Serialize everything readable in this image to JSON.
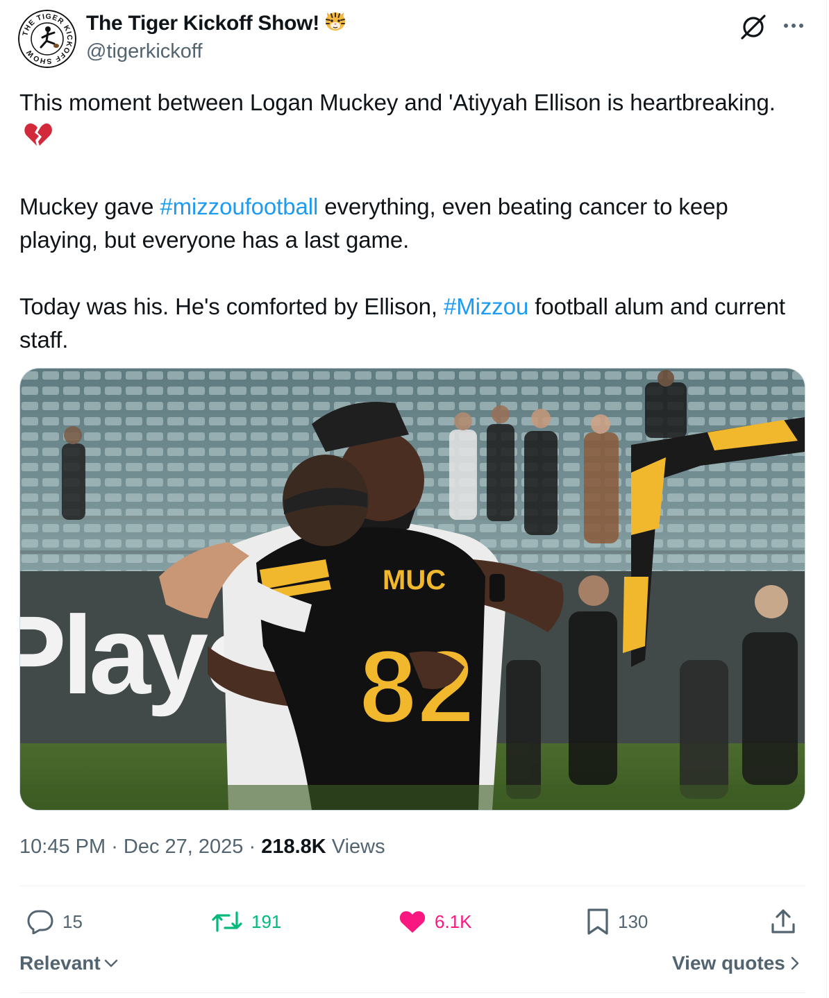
{
  "author": {
    "display_name": "The Tiger Kickoff Show!",
    "handle": "@tigerkickoff",
    "avatar_ring_text": "THE TIGER KICKOFF SHOW",
    "name_emoji": "tiger-face-emoji"
  },
  "tweet": {
    "p1_text": "This moment between Logan Muckey and 'Atiyyah Ellison is heartbreaking.",
    "p1_emoji": "broken-heart-emoji",
    "p2_before": "Muckey gave ",
    "p2_hashtag": "#mizzoufootball",
    "p2_after": " everything, even beating cancer to keep playing, but everyone has a last game.",
    "p3_before": "Today was his. He's comforted by Ellison, ",
    "p3_hashtag": "#Mizzou",
    "p3_after": " football alum and current staff."
  },
  "media": {
    "banner_text": "Playe",
    "jersey_name": "MUC",
    "jersey_number": "82"
  },
  "meta": {
    "time": "10:45 PM",
    "sep1": " · ",
    "date": "Dec 27, 2025",
    "sep2": " · ",
    "views_count": "218.8K",
    "views_label": " Views"
  },
  "actions": {
    "replies": "15",
    "reposts": "191",
    "likes": "6.1K",
    "bookmarks": "130"
  },
  "footer": {
    "sort_label": "Relevant",
    "quotes_label": "View quotes"
  },
  "colors": {
    "link": "#1d9bf0",
    "secondary_text": "#536471",
    "repost_green": "#00ba7c",
    "like_pink": "#f91880",
    "mizzou_gold": "#f1b82d",
    "divider": "#eff3f4"
  }
}
